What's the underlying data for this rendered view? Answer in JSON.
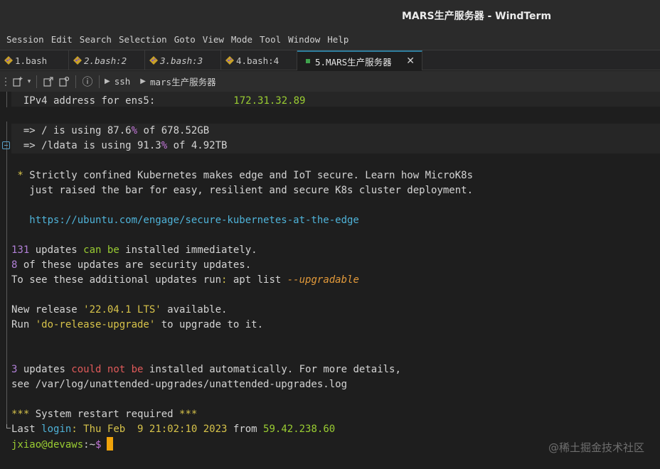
{
  "window": {
    "title": "MARS生产服务器 - WindTerm"
  },
  "menu": [
    "Session",
    "Edit",
    "Search",
    "Selection",
    "Goto",
    "View",
    "Mode",
    "Tool",
    "Window",
    "Help"
  ],
  "tabs": [
    {
      "label": "1.bash",
      "italic": false
    },
    {
      "label": "2.bash:2",
      "italic": true
    },
    {
      "label": "3.bash:3",
      "italic": true
    },
    {
      "label": "4.bash:4",
      "italic": false
    },
    {
      "label": "5.MARS生产服务器",
      "italic": false,
      "active": true
    }
  ],
  "tab_close_glyph": "✕",
  "toolbar": {
    "info_glyph": "ⓘ",
    "breadcrumbs": [
      "ssh",
      "mars生产服务器"
    ]
  },
  "terminal": {
    "ipv4_label": "  IPv4 address for ens5:",
    "ipv4_value": "172.31.32.89",
    "disk1_a": "  => / is using 87.6",
    "disk1_pct": "%",
    "disk1_b": " of 678.52GB",
    "disk2_a": "  => /ldata is using 91.3",
    "disk2_pct": "%",
    "disk2_b": " of 4.92TB",
    "notice_star": " *",
    "notice_1": " Strictly confined Kubernetes makes edge and IoT secure. Learn how MicroK8s",
    "notice_2": "   just raised the bar for easy, resilient and secure K8s cluster deployment.",
    "notice_url": "   https://ubuntu.com/engage/secure-kubernetes-at-the-edge",
    "upd_count": "131",
    "upd_a": " updates ",
    "upd_can": "can",
    "upd_sp": " ",
    "upd_be": "be",
    "upd_b": " installed immediately.",
    "sec_count": "8",
    "sec_text": " of these updates are security updates.",
    "see_a": "To see these additional updates run",
    "see_colon": ":",
    "see_b": " apt list ",
    "see_flag": "--upgradable",
    "rel_a": "New release ",
    "rel_ver": "'22.04.1 LTS'",
    "rel_b": " available.",
    "run_a": "Run ",
    "run_cmd": "'do-release-upgrade'",
    "run_b": " to upgrade to it.",
    "auto_count": "3",
    "auto_a": " updates ",
    "auto_could": "could",
    "auto_sp1": " ",
    "auto_not": "not",
    "auto_sp2": " ",
    "auto_be": "be",
    "auto_b": " installed automatically. For more details,",
    "log_path": "see /var/log/unattended-upgrades/unattended-upgrades.log",
    "restart_a": "***",
    "restart_b": " System restart required ",
    "restart_c": "***",
    "last_a": "Last ",
    "last_login": "login",
    "last_colon": ":",
    "last_date": " Thu Feb  9 21:02:10 2023",
    "last_from": " from ",
    "last_ip": "59.42.238.60",
    "prompt_user": "jxiao@devaws",
    "prompt_sep": ":~",
    "prompt_sym": "$"
  },
  "watermark": "@稀土掘金技术社区",
  "colors": {
    "accent": "#2e7d9c",
    "cursor": "#f0a30a",
    "green": "#9acd32",
    "magenta": "#c678dd",
    "cyan": "#4fb3d9",
    "yellow": "#d7c34a",
    "orange": "#e39a3a",
    "red": "#e05a5a"
  }
}
